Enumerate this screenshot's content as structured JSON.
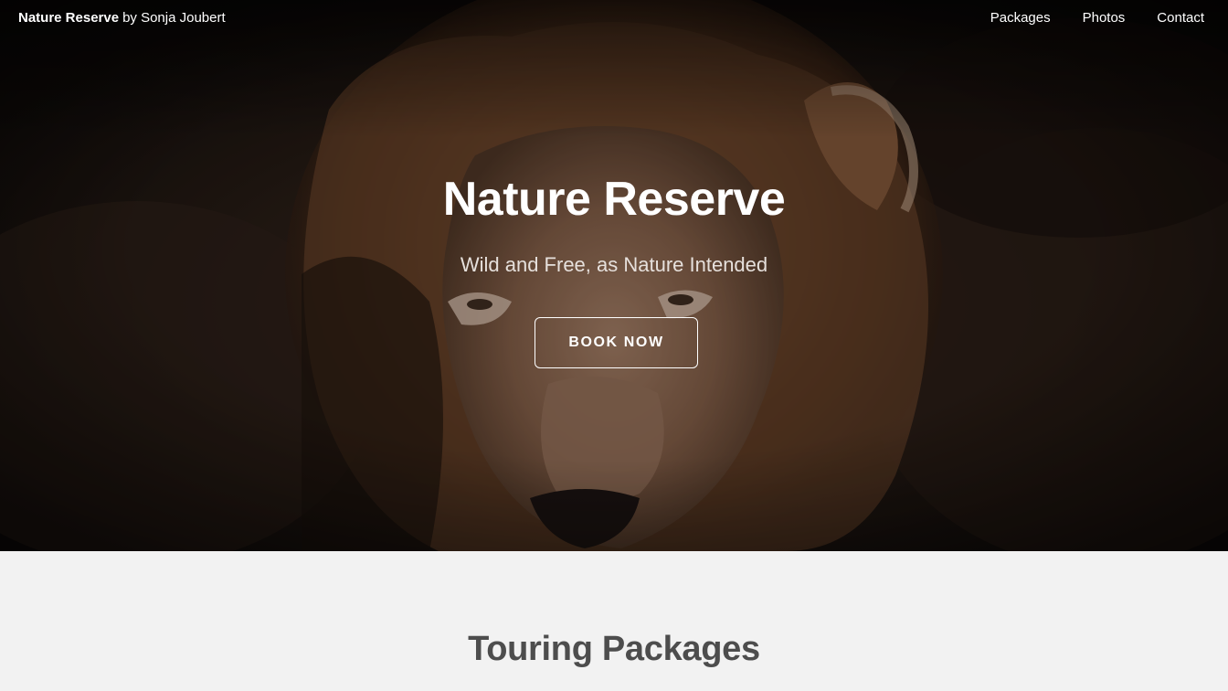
{
  "navbar": {
    "brand_name": "Nature Reserve",
    "brand_author": "by Sonja Joubert",
    "links": [
      "Packages",
      "Photos",
      "Contact"
    ]
  },
  "hero": {
    "title": "Nature Reserve",
    "subtitle": "Wild and Free, as Nature Intended",
    "cta_label": "BOOK NOW",
    "image_subject": "lion-portrait"
  },
  "packages": {
    "title": "Touring Packages"
  },
  "colors": {
    "hero_dark": "#1a1411",
    "mane": "#7a5232",
    "section_bg": "#f2f2f2",
    "section_title": "#4d4d4d",
    "text_white": "#ffffff"
  }
}
